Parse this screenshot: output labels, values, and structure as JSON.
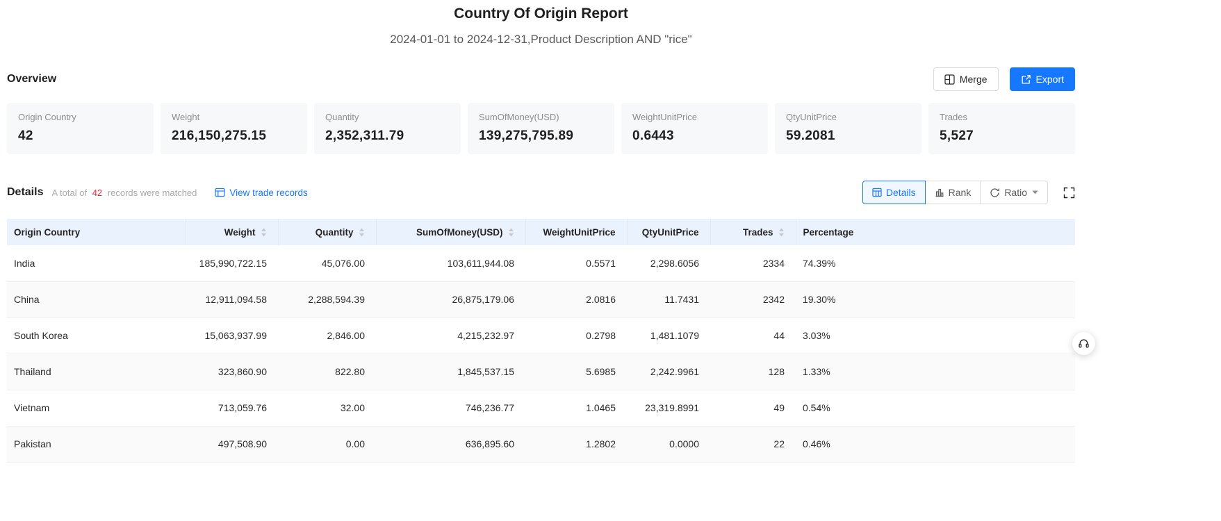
{
  "header": {
    "title": "Country Of Origin Report",
    "subtitle": "2024-01-01 to 2024-12-31,Product Description AND \"rice\""
  },
  "overview": {
    "section_label": "Overview",
    "merge_button": "Merge",
    "export_button": "Export",
    "cards": [
      {
        "label": "Origin Country",
        "value": "42"
      },
      {
        "label": "Weight",
        "value": "216,150,275.15"
      },
      {
        "label": "Quantity",
        "value": "2,352,311.79"
      },
      {
        "label": "SumOfMoney(USD)",
        "value": "139,275,795.89"
      },
      {
        "label": "WeightUnitPrice",
        "value": "0.6443"
      },
      {
        "label": "QtyUnitPrice",
        "value": "59.2081"
      },
      {
        "label": "Trades",
        "value": "5,527"
      }
    ]
  },
  "details": {
    "section_label": "Details",
    "matched_prefix": "A total of",
    "matched_count": "42",
    "matched_suffix": "records were matched",
    "view_trade_records": "View trade records",
    "view_buttons": {
      "details": "Details",
      "rank": "Rank",
      "ratio": "Ratio"
    }
  },
  "table": {
    "columns": [
      {
        "label": "Origin Country",
        "sortable": false,
        "align": "left"
      },
      {
        "label": "Weight",
        "sortable": true,
        "align": "right"
      },
      {
        "label": "Quantity",
        "sortable": true,
        "align": "right"
      },
      {
        "label": "SumOfMoney(USD)",
        "sortable": true,
        "align": "right"
      },
      {
        "label": "WeightUnitPrice",
        "sortable": false,
        "align": "right"
      },
      {
        "label": "QtyUnitPrice",
        "sortable": false,
        "align": "right"
      },
      {
        "label": "Trades",
        "sortable": true,
        "align": "right"
      },
      {
        "label": "Percentage",
        "sortable": false,
        "align": "left"
      }
    ],
    "rows": [
      {
        "cells": [
          "India",
          "185,990,722.15",
          "45,076.00",
          "103,611,944.08",
          "0.5571",
          "2,298.6056",
          "2334",
          "74.39%"
        ]
      },
      {
        "cells": [
          "China",
          "12,911,094.58",
          "2,288,594.39",
          "26,875,179.06",
          "2.0816",
          "11.7431",
          "2342",
          "19.30%"
        ]
      },
      {
        "cells": [
          "South Korea",
          "15,063,937.99",
          "2,846.00",
          "4,215,232.97",
          "0.2798",
          "1,481.1079",
          "44",
          "3.03%"
        ]
      },
      {
        "cells": [
          "Thailand",
          "323,860.90",
          "822.80",
          "1,845,537.15",
          "5.6985",
          "2,242.9961",
          "128",
          "1.33%"
        ]
      },
      {
        "cells": [
          "Vietnam",
          "713,059.76",
          "32.00",
          "746,236.77",
          "1.0465",
          "23,319.8991",
          "49",
          "0.54%"
        ]
      },
      {
        "cells": [
          "Pakistan",
          "497,508.90",
          "0.00",
          "636,895.60",
          "1.2802",
          "0.0000",
          "22",
          "0.46%"
        ]
      }
    ]
  },
  "icons": {
    "merge_icon": "grid-merge",
    "export_icon": "arrow-out-of-box",
    "view_records_icon": "trade-table",
    "details_view_icon": "table-grid",
    "rank_view_icon": "bar-chart",
    "ratio_view_icon": "circular-arrows",
    "caret_down_icon": "caret-down",
    "fullscreen_icon": "expand-corners",
    "sort_icon": "caret-up-down",
    "headset_icon": "customer-support-headset"
  },
  "colors": {
    "accent_blue": "#1677ff",
    "count_red": "#f5222d",
    "table_header_bg": "#eaf2fd",
    "card_bg": "#f7f8fa"
  }
}
